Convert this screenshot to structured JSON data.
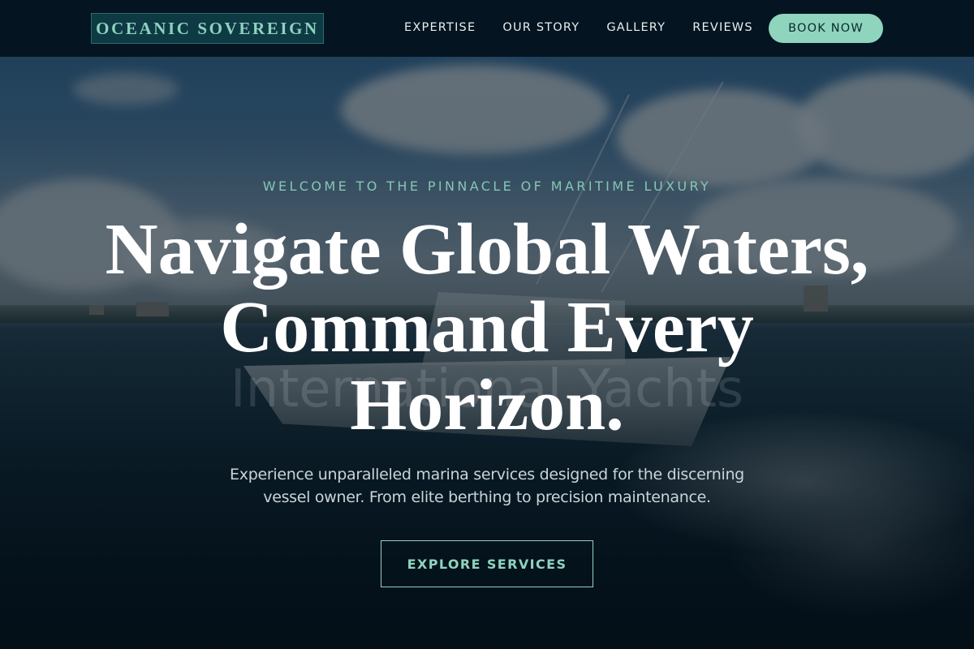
{
  "brand": {
    "name": "OCEANIC SOVEREIGN"
  },
  "nav": {
    "items": [
      {
        "label": "EXPERTISE"
      },
      {
        "label": "OUR STORY"
      },
      {
        "label": "GALLERY"
      },
      {
        "label": "REVIEWS"
      }
    ],
    "cta_label": "BOOK NOW"
  },
  "hero": {
    "kicker": "WELCOME TO THE PINNACLE OF MARITIME LUXURY",
    "headline_lines": [
      "Navigate Global Waters,",
      "Command Every",
      "Horizon."
    ],
    "ghost_text": "International Yachts",
    "subtext": "Experience unparalleled marina services designed for the discerning vessel owner. From elite berthing to precision maintenance.",
    "cta_label": "EXPLORE SERVICES",
    "background_image": "sport-fishing-yacht-on-open-water"
  },
  "colors": {
    "navbar_bg": "#041420",
    "accent": "#8fd4bd",
    "logo_bg": "#0e3a44",
    "logo_text": "#8fd1c0",
    "kicker": "#86c6b4"
  }
}
